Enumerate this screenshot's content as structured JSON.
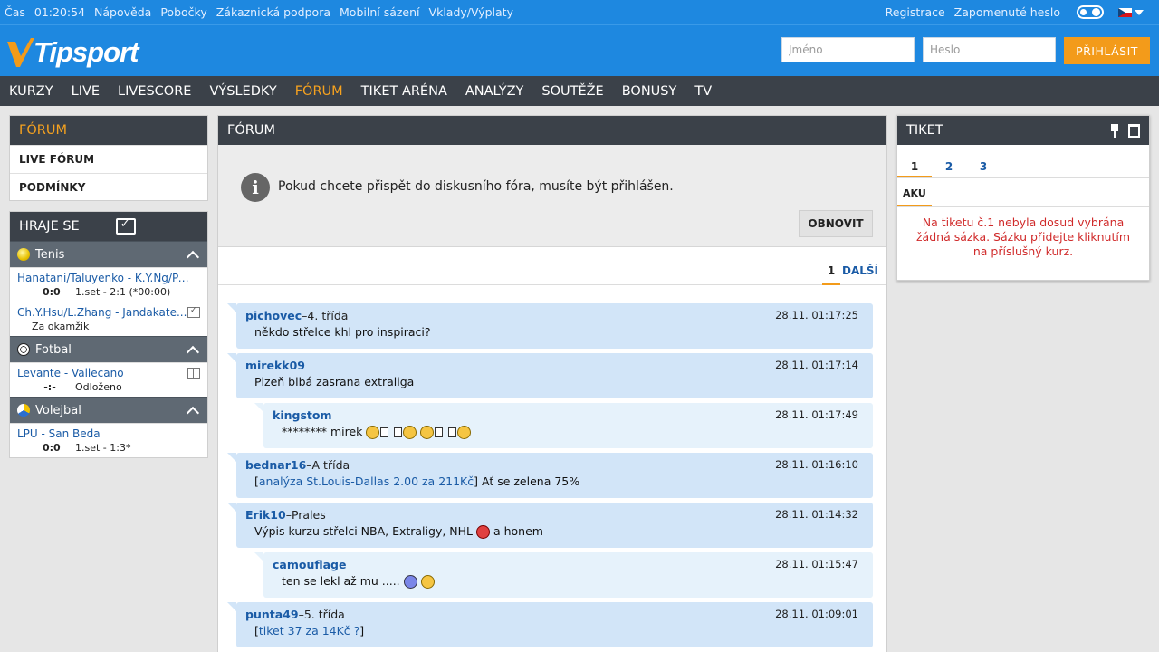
{
  "topbar": {
    "time_label": "Čas",
    "time_value": "01:20:54",
    "links": [
      "Nápověda",
      "Pobočky",
      "Zákaznická podpora",
      "Mobilní sázení",
      "Vklady/Výplaty"
    ],
    "register": "Registrace",
    "forgot": "Zapomenuté heslo"
  },
  "header": {
    "logo_text": "Tipsport",
    "brand_color": "#1e88e0",
    "accent_color": "#f39b1a",
    "username_placeholder": "Jméno",
    "password_placeholder": "Heslo",
    "login_label": "PŘIHLÁSIT"
  },
  "nav": {
    "items": [
      "KURZY",
      "LIVE",
      "LIVESCORE",
      "VÝSLEDKY",
      "FÓRUM",
      "TIKET ARÉNA",
      "ANALÝZY",
      "SOUTĚŽE",
      "BONUSY",
      "TV"
    ],
    "active": "FÓRUM"
  },
  "left_forum": {
    "title": "FÓRUM",
    "items": [
      "LIVE FÓRUM",
      "PODMÍNKY"
    ]
  },
  "live_panel": {
    "title": "HRAJE SE",
    "sports": [
      {
        "name": "Tenis",
        "icon": "tennis-ball-icon",
        "matches": [
          {
            "teams": "Hanatani/Taluyenko - K.Y.Ng/Palha",
            "score": "0:0",
            "status": "1.set - 2:1 (*00:00)",
            "icon": ""
          },
          {
            "teams": "Ch.Y.Hsu/L.Zhang - Jandakate...",
            "score": "",
            "status": "Za okamžik",
            "icon": "tv-icon"
          }
        ]
      },
      {
        "name": "Fotbal",
        "icon": "football-icon",
        "matches": [
          {
            "teams": "Levante - Vallecano",
            "score": "-:-",
            "status": "Odloženo",
            "icon": "pitch-icon"
          }
        ]
      },
      {
        "name": "Volejbal",
        "icon": "volleyball-icon",
        "matches": [
          {
            "teams": "LPU - San Beda",
            "score": "0:0",
            "status": "1.set - 1:3*",
            "icon": ""
          }
        ]
      }
    ]
  },
  "forum": {
    "title": "FÓRUM",
    "notice": "Pokud chcete přispět do diskusního fóra, musíte být přihlášen.",
    "refresh_label": "OBNOVIT",
    "page": "1",
    "next_label": "DALŠÍ",
    "posts": [
      {
        "author": "pichovec",
        "rank": "4. třída",
        "time": "28.11. 01:17:25",
        "text": "někdo střelce khl pro inspiraci?",
        "reply": false
      },
      {
        "author": "mirekk09",
        "rank": "",
        "time": "28.11. 01:17:14",
        "text": "Plzeň blbá zasrana extraliga",
        "reply": false
      },
      {
        "author": "kingstom",
        "rank": "",
        "time": "28.11. 01:17:49",
        "text": "******** mirek",
        "reply": true
      },
      {
        "author": "bednar16",
        "rank": "A třída",
        "time": "28.11. 01:16:10",
        "link": "analýza St.Louis-Dallas 2.00 za 211Kč",
        "text": " Ať se zelena 75%",
        "reply": false
      },
      {
        "author": "Erik10",
        "rank": "Prales",
        "time": "28.11. 01:14:32",
        "text": "Výpis kurzu střelci NBA, Extraligy, NHL",
        "text2": "a honem",
        "reply": false
      },
      {
        "author": "camouflage",
        "rank": "",
        "time": "28.11. 01:15:47",
        "text": "ten se lekl až mu .....",
        "reply": true
      },
      {
        "author": "punta49",
        "rank": "5. třída",
        "time": "28.11. 01:09:01",
        "link": "tiket 37 za 14Kč ?",
        "text": "",
        "reply": false
      }
    ]
  },
  "ticket": {
    "title": "TIKET",
    "tabs": [
      "1",
      "2",
      "3"
    ],
    "active_tab": "1",
    "sub_tab": "AKU",
    "empty_message": "Na tiketu č.1 nebyla dosud vybrána žádná sázka. Sázku přidejte kliknutím na příslušný kurz."
  }
}
